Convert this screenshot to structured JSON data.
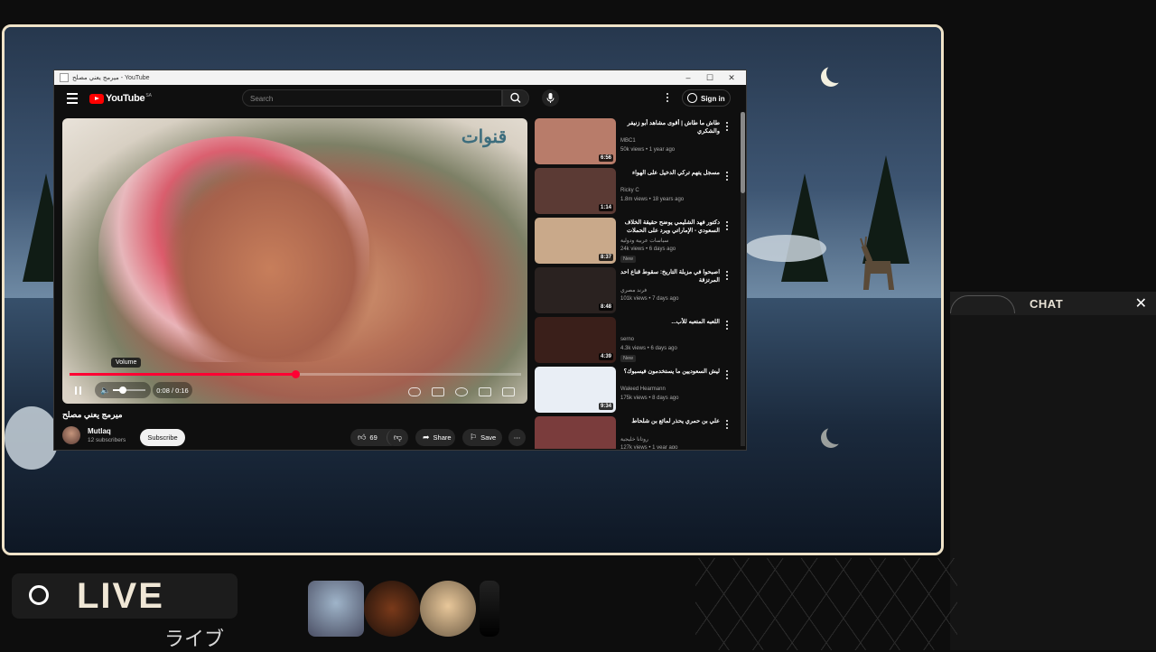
{
  "window": {
    "title": "ميرمج يعني مصلح - YouTube",
    "controls": [
      "–",
      "☐",
      "✕"
    ]
  },
  "youtube": {
    "logo_text": "YouTube",
    "region": "SA",
    "search_placeholder": "Search",
    "signin_label": "Sign in",
    "player": {
      "tooltip": "Volume",
      "time": "0:08 / 0:16",
      "progress_fraction": 0.5,
      "volume_fraction": 0.3,
      "watermark": "ﻗﻨﻮﺍﺕ"
    },
    "video": {
      "title": "ميرمج يعني مصلح",
      "channel": "Mutlaq",
      "subscribers": "12 subscribers",
      "subscribe_label": "Subscribe",
      "likes": "69",
      "share_label": "Share",
      "save_label": "Save"
    },
    "related": [
      {
        "title": "طاش ما طاش | أقوى مشاهد أبو زنيفر والشكري",
        "channel": "MBC1",
        "meta": "50k views • 1 year ago",
        "duration": "6:56",
        "badge": "",
        "thumb": "#b87c6a"
      },
      {
        "title": "مسجل يتهم تركي الدخيل على الهواء",
        "channel": "Ricky C",
        "meta": "1.8m views • 18 years ago",
        "duration": "1:14",
        "badge": "",
        "thumb": "#5b3a34"
      },
      {
        "title": "دكتور فهد الشليمي يوضح حقيقة الخلاف السعودي - الإماراتي ويرد على الحملات ...",
        "channel": "سياسات عربية ودولية",
        "meta": "24k views • 6 days ago",
        "duration": "8:37",
        "badge": "New",
        "thumb": "#c9a98a"
      },
      {
        "title": "اصبحوا في مزبلة التاريخ: سقوط قناع احد المرتزقة",
        "channel": "فرند مصري",
        "meta": "101k views • 7 days ago",
        "duration": "8:48",
        "badge": "",
        "thumb": "#2a2220"
      },
      {
        "title": "اللعبه المتعبه للأب...",
        "channel": "serno",
        "meta": "4.3k views • 6 days ago",
        "duration": "4:39",
        "badge": "New",
        "thumb": "#3a1f1a"
      },
      {
        "title": "ليش السعوديين ما يستخدمون فيسبوك؟",
        "channel": "Waleed Hearmann",
        "meta": "175k views • 8 days ago",
        "duration": "9:34",
        "badge": "",
        "thumb": "#e9eef5"
      },
      {
        "title": "علي بن حمري يحذر لمائع بن شلحاط",
        "channel": "روتانا خليجية",
        "meta": "127k views • 1 year ago",
        "duration": "",
        "badge": "",
        "thumb": "#7a3c3c"
      }
    ]
  },
  "overlay": {
    "chat_title": "CHAT",
    "chat_close": "✕",
    "live_label": "LIVE",
    "live_japanese": "ライブ"
  },
  "colors": {
    "frame_border": "#efe3c8",
    "yt_red": "#ff0000",
    "progress_red": "#ff0033",
    "yt_bg": "#0f0f0f"
  },
  "icons": {
    "menu": "hamburger-icon",
    "search": "search-icon",
    "mic": "microphone-icon",
    "more": "more-vert-icon",
    "like": "thumbs-up-icon",
    "dislike": "thumbs-down-icon",
    "share": "share-icon",
    "save": "bookmark-icon"
  }
}
